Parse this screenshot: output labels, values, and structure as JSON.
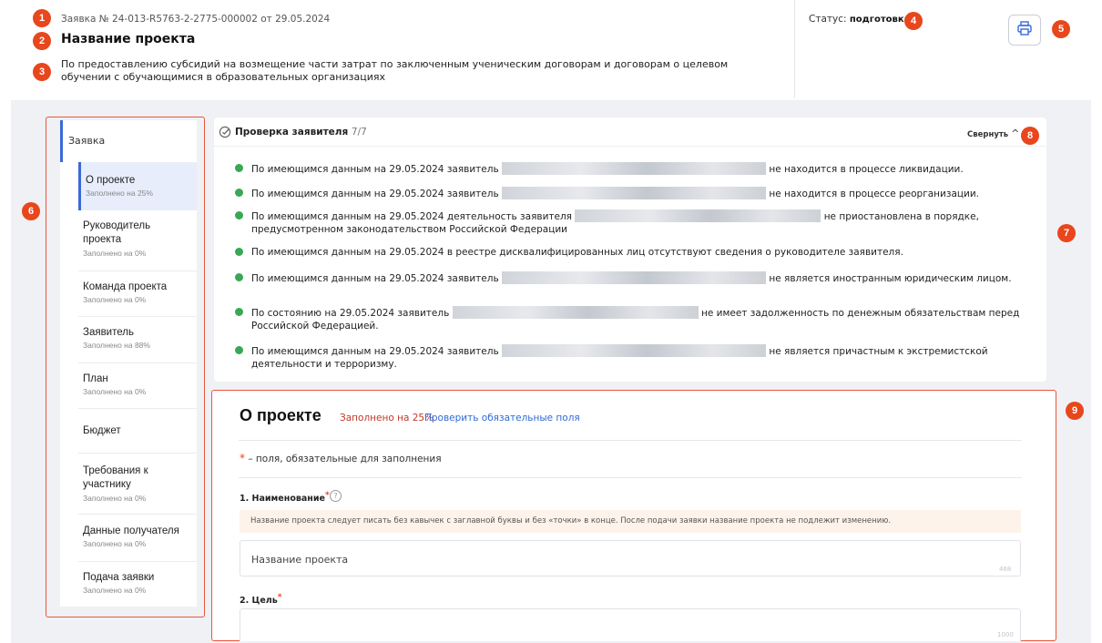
{
  "header": {
    "application_number": "Заявка № 24-013-R5763-2-2775-000002 от 29.05.2024",
    "project_title": "Название проекта",
    "project_description": "По предоставлению субсидий на возмещение части затрат по заключенным ученическим договорам и договорам о целевом обучении с обучающимися в образовательных организациях",
    "status_label": "Статус:",
    "status_value": "подготовка",
    "print_icon": "printer-icon"
  },
  "markers": [
    "1",
    "2",
    "3",
    "4",
    "5",
    "6",
    "7",
    "8",
    "9"
  ],
  "sidebar": {
    "root_label": "Заявка",
    "items": [
      {
        "label": "О проекте",
        "sub": "Заполнено на 25%",
        "active": true
      },
      {
        "label": "Руководитель проекта",
        "sub": "Заполнено на 0%"
      },
      {
        "label": "Команда проекта",
        "sub": "Заполнено на 0%"
      },
      {
        "label": "Заявитель",
        "sub": "Заполнено на 88%"
      },
      {
        "label": "План",
        "sub": "Заполнено на 0%"
      },
      {
        "label": "Бюджет",
        "sub": ""
      },
      {
        "label": "Требования к участнику",
        "sub": "Заполнено на 0%"
      },
      {
        "label": "Данные получателя",
        "sub": "Заполнено на 0%"
      },
      {
        "label": "Подача заявки",
        "sub": "Заполнено на 0%"
      }
    ]
  },
  "check_panel": {
    "title": "Проверка заявителя",
    "count": "7/7",
    "collapse_label": "Свернуть",
    "rows": [
      {
        "before": "По имеющимся данным на 29.05.2024 заявитель",
        "after": "не находится в процессе ликвидации."
      },
      {
        "before": "По имеющимся данным на 29.05.2024 заявитель",
        "after": "не находится в процессе реорганизации."
      },
      {
        "before": "По имеющимся данным на 29.05.2024 деятельность заявителя",
        "after": "не приостановлена в порядке, предусмотренном законодательством Российской Федерации"
      },
      {
        "before": "По имеющимся данным на 29.05.2024 в реестре дисквалифицированных лиц отсутствуют сведения о руководителе заявителя.",
        "after": ""
      },
      {
        "before": "По имеющимся данным на 29.05.2024 заявитель",
        "after": "не является иностранным юридическим лицом."
      },
      {
        "before": "По состоянию на 29.05.2024 заявитель",
        "after": "не имеет задолженность по денежным обязательствам перед Российской Федерацией."
      },
      {
        "before": "По имеющимся данным на 29.05.2024 заявитель",
        "after": "не является причастным к экстремистской деятельности и терроризму."
      }
    ]
  },
  "project_section": {
    "title": "О проекте",
    "fill_status": "Заполнено на 25%",
    "check_required_link": "Проверить обязательные поля",
    "required_note_star": "*",
    "required_note": "– поля, обязательные для заполнения",
    "field1_label": "1. Наименование",
    "field1_hint": "Название проекта следует писать без кавычек с заглавной буквы и без «точки» в конце. После подачи заявки название проекта не подлежит изменению.",
    "field1_value": "Название проекта",
    "field1_counter": "468",
    "field2_label": "2. Цель",
    "field2_counter": "1000"
  }
}
